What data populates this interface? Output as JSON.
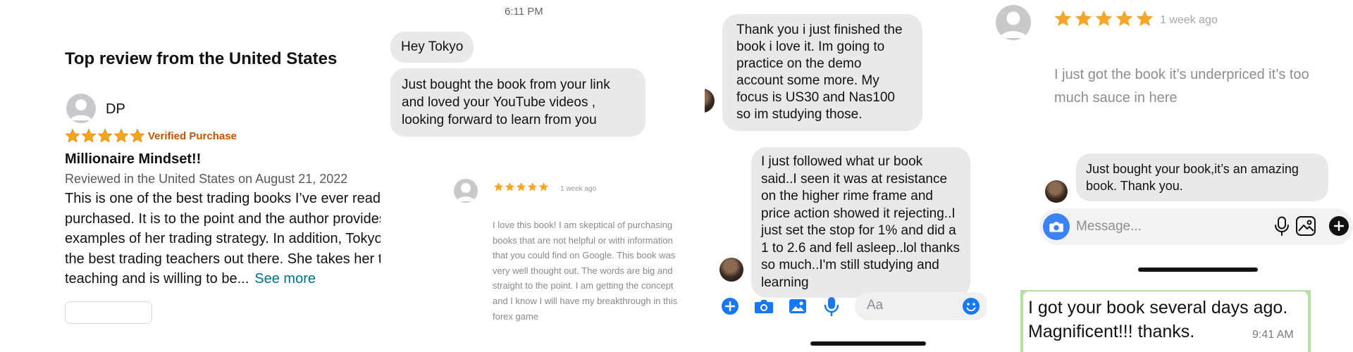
{
  "amazon_review": {
    "section_title": "Top review from the United States",
    "reviewer_name": "DP",
    "rating": 5,
    "verified_label": "Verified Purchase",
    "headline": "Millionaire Mindset!!",
    "meta": "Reviewed in the United States on August 21, 2022",
    "body": "This is one of the best trading books I’ve ever read and purchased. It is to the point and the author provides examples of her trading strategy. In addition, Tokyo is one of the best trading teachers out there. She takes her time when teaching and is willing to be...",
    "see_more": "See more"
  },
  "chat_one": {
    "time": "6:11 PM",
    "messages": [
      "Hey Tokyo",
      "Just bought the book from your link and loved your YouTube videos , looking forward to learn from you"
    ]
  },
  "small_review": {
    "rating": 5,
    "age": "1 week ago",
    "body": "I love this book! I am skeptical of purchasing books that are not helpful or with information that you could find on Google. This book was very well thought out. The words are big and straight to the point. I am getting the concept and I know I will have my breakthrough in this forex game"
  },
  "messenger": {
    "messages": [
      "Thank you i just finished the book i love it. Im going to practice on the demo account some more. My focus is US30 and Nas100 so im studying those.",
      "I just followed what ur book said..I seen it was at resistance   on the higher rime frame and price action showed it rejecting..I just set the stop for 1% and did a 1 to 2.6 and fell asleep..lol thanks so much..I'm still studying and learning"
    ],
    "input_placeholder": "Aa",
    "tools": [
      "plus-circle-icon",
      "camera-icon",
      "photo-icon",
      "microphone-icon"
    ],
    "accent_color": "#1877f2"
  },
  "review_two": {
    "rating": 5,
    "age": "1 week ago",
    "body": "I just got the book it’s underpriced it’s too much sauce in here"
  },
  "instagram_dm": {
    "message": "Just bought your book,it’s an amazing book. Thank you.",
    "input_placeholder": "Message..."
  },
  "whatsapp": {
    "message": "I got your book several days ago. Magnificent!!!  thanks.",
    "time": "9:41 AM",
    "background_color": "#b8dfa3"
  },
  "colors": {
    "star_orange": "#f7a51c",
    "star_review": "#f4a62a",
    "verified_orange": "#c45500",
    "link_teal": "#007185"
  }
}
